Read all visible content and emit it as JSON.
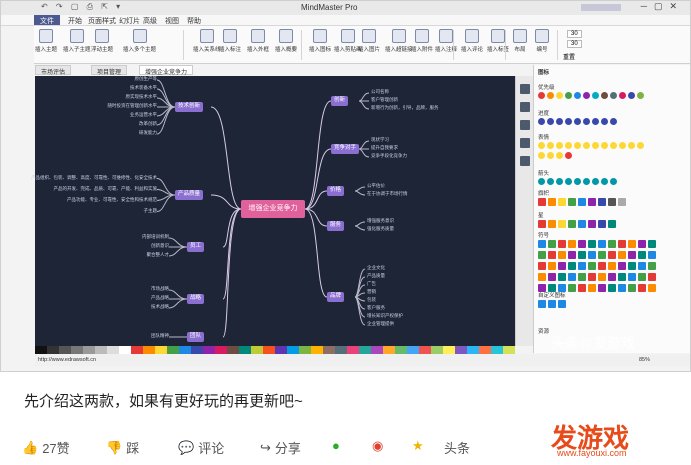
{
  "app_title": "MindMaster Pro",
  "menu": [
    "文件",
    "开始",
    "页面样式",
    "幻灯片",
    "高级",
    "视图",
    "帮助"
  ],
  "ribbon": [
    "插入主题",
    "插入子主题",
    "浮动主题",
    "插入多个主题",
    "插入关系线",
    "插入标注",
    "插入外框",
    "插入概要",
    "插入图标",
    "插入剪贴画",
    "插入图片",
    "插入超链接",
    "插入附件",
    "插入注释",
    "插入评论",
    "插入标签",
    "布局",
    "编号"
  ],
  "ribbon_spin": [
    "30",
    "30"
  ],
  "ribbon_reset": "重置",
  "tabs": [
    "市场评估",
    "项目管理",
    "增强企业竞争力"
  ],
  "central": "增强企业竞争力",
  "branches_right": [
    {
      "label": "创新",
      "leaves": [
        "公司名称",
        "客户管理创新",
        "新增行为创新，引导，品牌，服务"
      ]
    },
    {
      "label": "竞争对手",
      "leaves": [
        "现状学习",
        "提升自我要求",
        "竞争手段化竞争力"
      ]
    },
    {
      "label": "价格",
      "leaves": [
        "公平估价",
        "在于协调于市场行情"
      ]
    },
    {
      "label": "服务",
      "leaves": [
        "增强服务意识",
        "强化服务质量"
      ]
    },
    {
      "label": "品牌",
      "leaves": [
        "企业文化",
        "产品质量",
        "广告",
        "营销",
        "包装",
        "客户服务",
        "增长知识产权保护",
        "企业管理提供"
      ]
    }
  ],
  "branches_left": [
    {
      "label": "技术创新",
      "leaves": [
        "原创生产等",
        "技术装备水平",
        "原实现技术水平",
        "随时投资在管理创新水平",
        "业务运营水平",
        "改革创新",
        "研发能力"
      ]
    },
    {
      "label": "产品质量",
      "leaves": [
        "产品组织、包装、调整、高度、可靠性、可维修性、化安全技术",
        "产品的开发、完成、品质、可靠、产能、利益和实施",
        "产品功能、专业、可靠性、安全性和技术规范",
        " 子主题"
      ]
    },
    {
      "label": "员工",
      "leaves": [
        "内部培训机制",
        "创新意识",
        "聚合整人才"
      ]
    },
    {
      "label": "战略",
      "leaves": [
        "市场战略",
        "产品战略",
        "技术战略"
      ]
    },
    {
      "label": "团队",
      "leaves": [
        "团队精神"
      ]
    }
  ],
  "status_url": "http://www.edrawsoft.cn",
  "status_zoom": "85%",
  "panel": {
    "title": "图标",
    "sections": [
      "优先级",
      "进度",
      "表情",
      "箭头",
      "旗帜",
      "星",
      "符号",
      "自定义图标"
    ],
    "more": "资源"
  },
  "caption": "先介绍这两款，如果有更好玩的再更新吧~",
  "actions": {
    "like": "27赞",
    "dislike": "踩",
    "comment": "评论",
    "share": "分享",
    "toutiao": "头条"
  },
  "watermark": {
    "main": "发游戏",
    "url": "www.fayouxi.com"
  },
  "watermark2": "头条@发游戏",
  "colors": {
    "accent": "#4d5a92",
    "node": "#8a6fd1",
    "central": "#e0619c",
    "canvas": "#1d2537",
    "wm": "#e84a1a"
  }
}
